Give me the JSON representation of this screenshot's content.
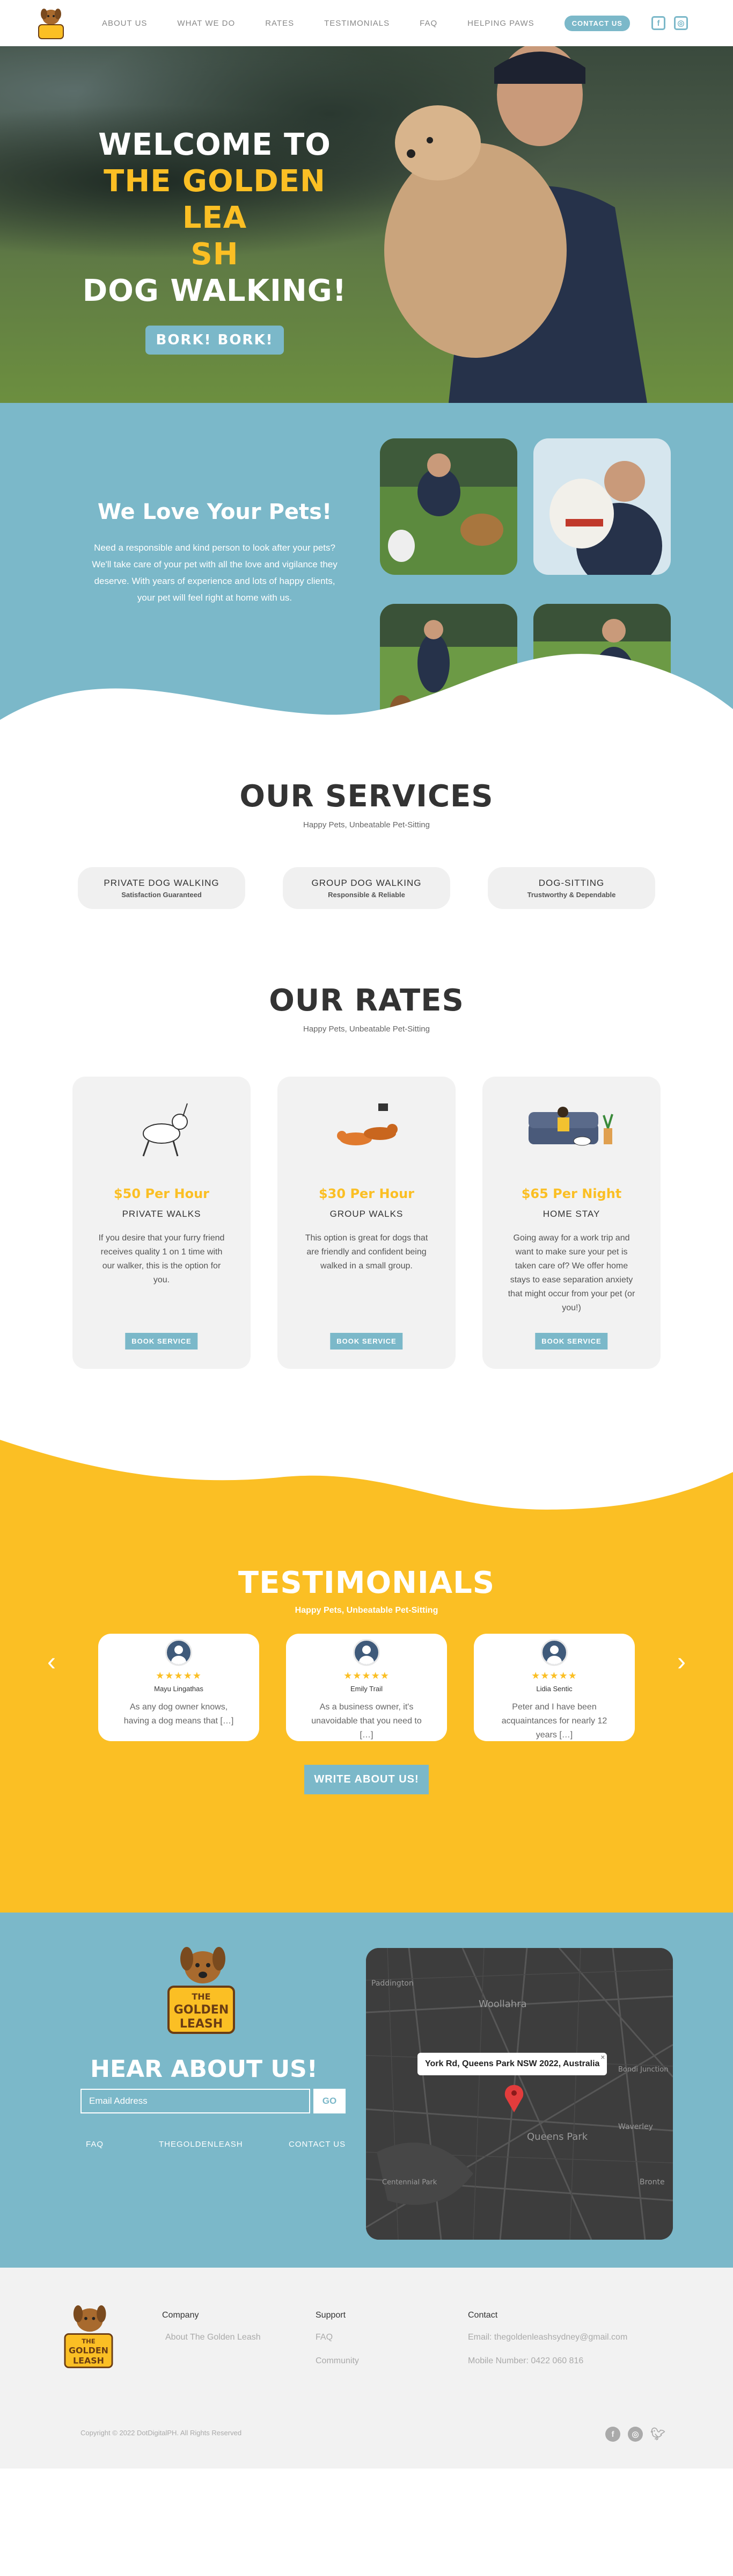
{
  "nav": {
    "links": [
      "ABOUT US",
      "WHAT WE DO",
      "RATES",
      "TESTIMONIALS",
      "FAQ",
      "HELPING PAWS"
    ],
    "cta": "CONTACT US",
    "social_icons": [
      "facebook-icon",
      "instagram-icon"
    ]
  },
  "hero": {
    "line1": "WELCOME TO",
    "line2": "THE GOLDEN LEA",
    "line3": "SH",
    "line4": "DOG WALKING!",
    "button": "BORK!  BORK!"
  },
  "love": {
    "title": "We Love Your Pets!",
    "body": "Need a responsible and kind person to look after your pets? We'll take care of your pet with all the love and vigilance they deserve. With years of experience and lots of happy clients, your pet will feel right at home with us."
  },
  "services": {
    "title": "OUR SERVICES",
    "subtitle": "Happy Pets, Unbeatable Pet-Sitting",
    "items": [
      {
        "name": "PRIVATE DOG WALKING",
        "tag": "Satisfaction Guaranteed"
      },
      {
        "name": "GROUP DOG WALKING",
        "tag": "Responsible & Reliable"
      },
      {
        "name": "DOG-SITTING",
        "tag": "Trustworthy & Dependable"
      }
    ]
  },
  "rates": {
    "title": "OUR RATES",
    "subtitle": "Happy Pets, Unbeatable Pet-Sitting",
    "cards": [
      {
        "price": "$50 Per Hour",
        "name": "PRIVATE WALKS",
        "desc": "If you desire that your furry friend receives quality 1 on 1 time with our walker, this is the option for you.",
        "button": "BOOK SERVICE"
      },
      {
        "price": "$30 Per Hour",
        "name": "GROUP WALKS",
        "desc": "This option is great for dogs that are friendly and confident being walked in a small group.",
        "button": "BOOK SERVICE"
      },
      {
        "price": "$65 Per Night",
        "name": "HOME STAY",
        "desc": "Going away for a work trip and want to make sure your pet is taken care of? We offer home stays to ease separation anxiety that might occur from your pet (or you!)",
        "button": "BOOK SERVICE"
      }
    ]
  },
  "testimonials": {
    "title": "TESTIMONIALS",
    "subtitle": "Happy Pets, Unbeatable Pet-Sitting",
    "items": [
      {
        "stars": "★★★★★",
        "name": "Mayu Lingathas",
        "text": "As any dog owner knows, having a dog means that […]"
      },
      {
        "stars": "★★★★★",
        "name": "Emily Trail",
        "text": "As a business owner, it's unavoidable that you need to […]"
      },
      {
        "stars": "★★★★★",
        "name": "Lidia Sentic",
        "text": "Peter and I have been acquaintances for nearly 12 years […]"
      }
    ],
    "prev": "‹",
    "next": "›",
    "write_button": "WRITE ABOUT US!"
  },
  "contact": {
    "title": "HEAR ABOUT US!",
    "email_placeholder": "Email Address",
    "go": "GO",
    "links": [
      "FAQ",
      "THEGOLDENLEASH",
      "CONTACT US"
    ],
    "map_label": "York Rd, Queens Park NSW 2022, Australia",
    "map_close": "×",
    "map_streets": [
      "Woollahra",
      "Queens Park",
      "Waverley",
      "Bondi Junction",
      "Paddington",
      "Centennial Park",
      "Bronte"
    ]
  },
  "logo": {
    "line1": "THE",
    "line2": "GOLDEN",
    "line3": "LEASH"
  },
  "footer": {
    "company_head": "Company",
    "company_items": [
      "About The Golden Leash"
    ],
    "support_head": "Support",
    "support_items": [
      "FAQ",
      "Community"
    ],
    "contact_head": "Contact",
    "contact_items": [
      "Email: thegoldenleashsydney@gmail.com",
      "Mobile Number: 0422 060 816"
    ],
    "copyright": "Copyright © 2022 DotDigitalPH. All Rights Reserved",
    "social_icons": [
      "facebook-icon",
      "instagram-icon",
      "twitter-icon"
    ]
  },
  "colors": {
    "accent": "#7bb8c9",
    "gold": "#fbbf24"
  }
}
